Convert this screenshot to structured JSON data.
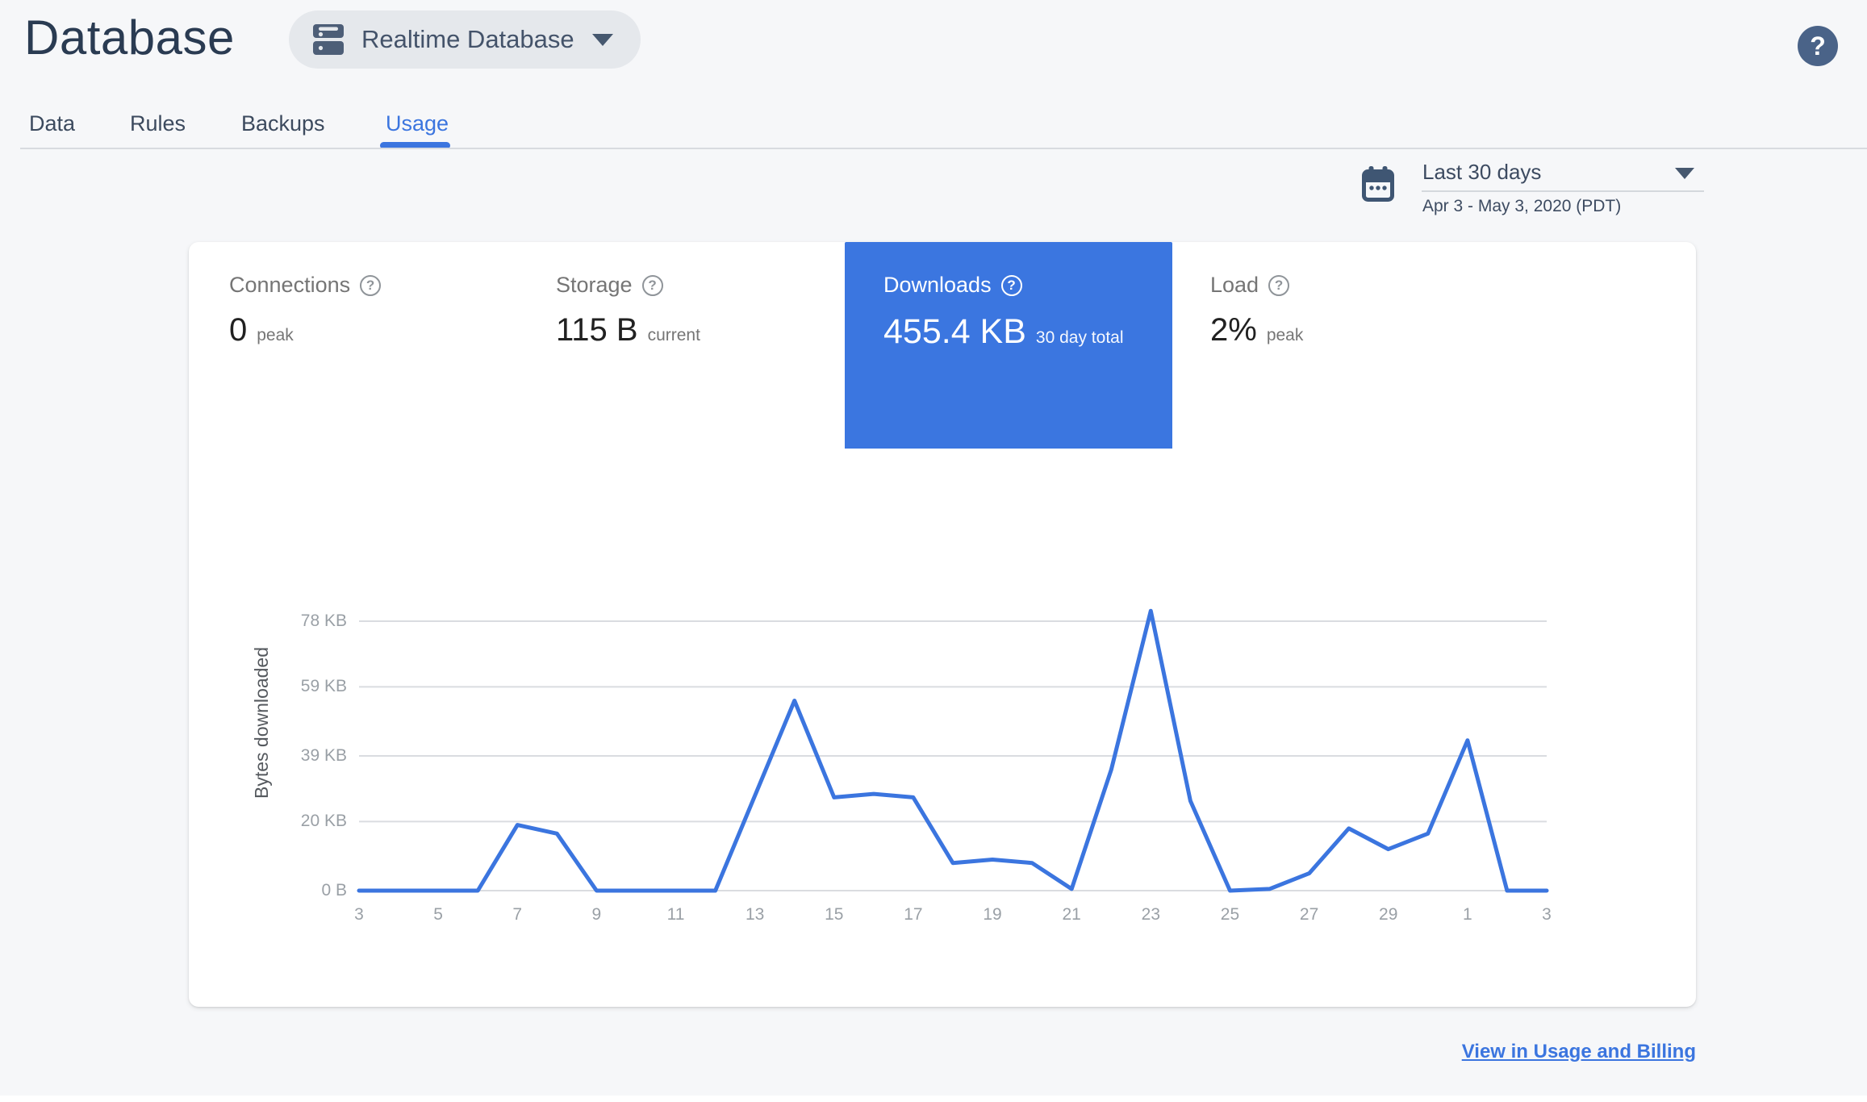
{
  "header": {
    "title": "Database",
    "instance_selector": {
      "label": "Realtime Database",
      "icon": "dns-icon"
    },
    "help_glyph": "?"
  },
  "tabs": [
    {
      "label": "Data",
      "active": false
    },
    {
      "label": "Rules",
      "active": false
    },
    {
      "label": "Backups",
      "active": false
    },
    {
      "label": "Usage",
      "active": true
    }
  ],
  "date_range": {
    "preset": "Last 30 days",
    "range": "Apr 3 - May 3, 2020 (PDT)"
  },
  "metrics": [
    {
      "key": "connections",
      "label": "Connections",
      "value": "0",
      "suffix": "peak",
      "selected": false
    },
    {
      "key": "storage",
      "label": "Storage",
      "value": "115 B",
      "suffix": "current",
      "selected": false
    },
    {
      "key": "downloads",
      "label": "Downloads",
      "value": "455.4 KB",
      "suffix": "30 day total",
      "selected": true
    },
    {
      "key": "load",
      "label": "Load",
      "value": "2%",
      "suffix": "peak",
      "selected": false
    }
  ],
  "icons": {
    "help_glyph": "?"
  },
  "chart_data": {
    "type": "line",
    "title": "Downloads — bytes downloaded per day",
    "xlabel": "",
    "ylabel": "Bytes downloaded",
    "categories": [
      "3",
      "4",
      "5",
      "6",
      "7",
      "8",
      "9",
      "10",
      "11",
      "12",
      "13",
      "14",
      "15",
      "16",
      "17",
      "18",
      "19",
      "20",
      "21",
      "22",
      "23",
      "24",
      "25",
      "26",
      "27",
      "28",
      "29",
      "30",
      "1",
      "2",
      "3"
    ],
    "values_kb": [
      0,
      0,
      0,
      0,
      19,
      16.5,
      0,
      0,
      0,
      0,
      27.5,
      55,
      27,
      28,
      27,
      8,
      9,
      8,
      0.5,
      35,
      81,
      26,
      0,
      0.5,
      5,
      18,
      12,
      16.5,
      43.5,
      0,
      0
    ],
    "x_tick_step": 2,
    "yticks": [
      {
        "value": 0,
        "label": "0 B"
      },
      {
        "value": 20,
        "label": "20 KB"
      },
      {
        "value": 39,
        "label": "39 KB"
      },
      {
        "value": 59,
        "label": "59 KB"
      },
      {
        "value": 78,
        "label": "78 KB"
      }
    ],
    "ylim": [
      0,
      82
    ],
    "grid": true,
    "legend": "none",
    "line_color": "#3B75DF"
  },
  "footer": {
    "link_label": "View in Usage and Billing"
  },
  "colors": {
    "accent": "#3B75DF",
    "tile_selected": "#3B76E0",
    "background": "#F6F7F9",
    "gridline": "#DADCE0",
    "tick_label": "#9AA0A6",
    "title_navy": "#2A3B52"
  }
}
